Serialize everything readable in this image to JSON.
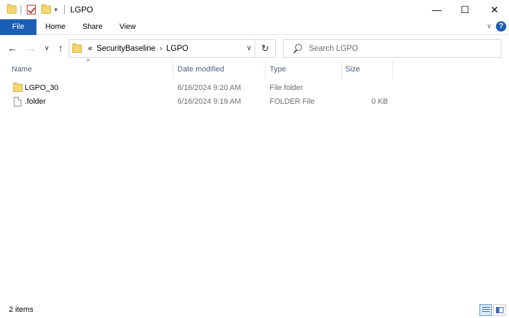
{
  "window": {
    "title": "LGPO",
    "minimize_glyph": "—",
    "maximize_glyph": "☐",
    "close_glyph": "✕"
  },
  "ribbon": {
    "tabs": [
      "File",
      "Home",
      "Share",
      "View"
    ],
    "help_glyph": "?",
    "expand_glyph": "∨"
  },
  "nav": {
    "back_glyph": "←",
    "forward_glyph": "→",
    "recent_glyph": "∨",
    "up_glyph": "↑"
  },
  "address": {
    "overflow": "«",
    "crumbs": [
      "SecurityBaseline",
      "LGPO"
    ],
    "separator": "›",
    "dropdown_glyph": "∨",
    "refresh_glyph": "↻"
  },
  "search": {
    "placeholder": "Search LGPO"
  },
  "columns": {
    "name": "Name",
    "date": "Date modified",
    "type": "Type",
    "size": "Size",
    "sort_glyph": "^"
  },
  "files": [
    {
      "name": "LGPO_30",
      "date": "6/16/2024 9:20 AM",
      "type": "File folder",
      "size": "",
      "icon": "folder-icon"
    },
    {
      "name": ".folder",
      "date": "6/16/2024 9:19 AM",
      "type": "FOLDER File",
      "size": "0 KB",
      "icon": "file-icon"
    }
  ],
  "status": {
    "item_count": "2 items"
  },
  "colors": {
    "accent": "#1b5fb4",
    "folder": "#f5d66e",
    "header_text": "#4c607a"
  }
}
